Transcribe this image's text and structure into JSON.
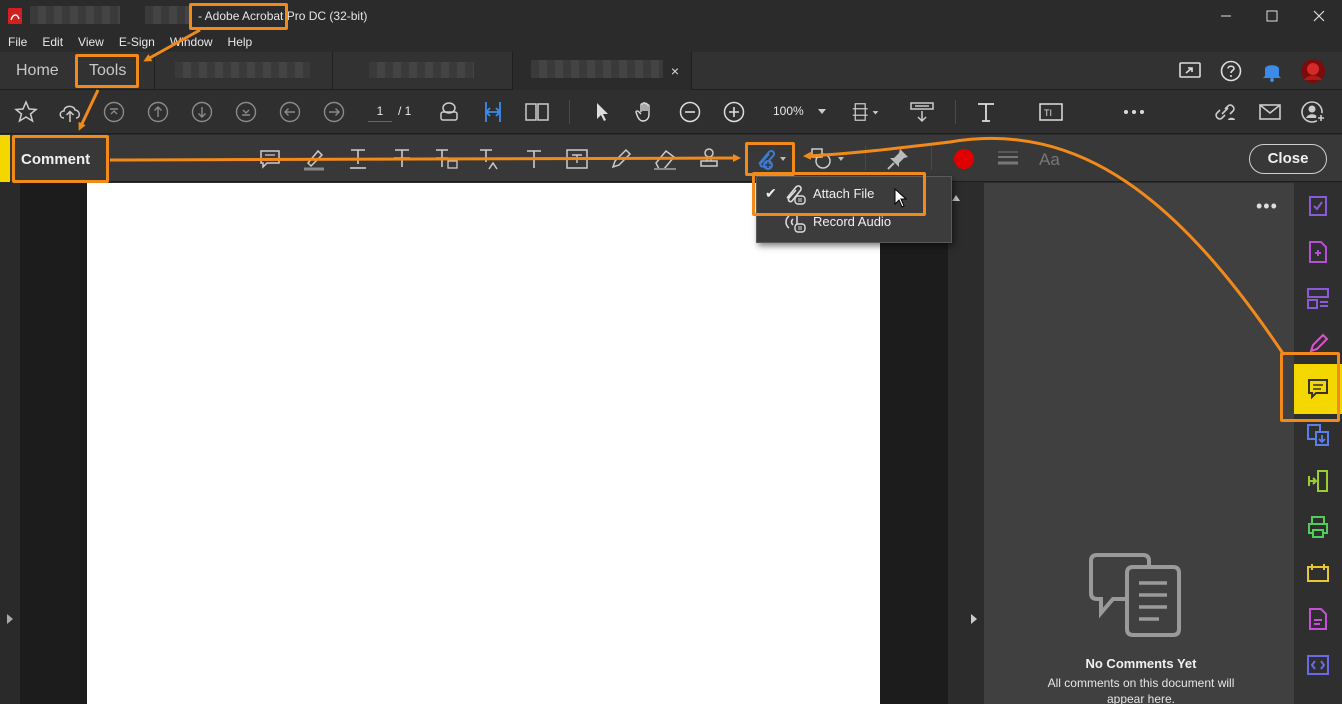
{
  "window": {
    "title": "- Adobe Acrobat Pro DC (32-bit)",
    "controls": [
      "minimize",
      "maximize",
      "close"
    ]
  },
  "menu": {
    "items": [
      "File",
      "Edit",
      "View",
      "E-Sign",
      "Window",
      "Help"
    ]
  },
  "tabs": {
    "home_label": "Home",
    "tools_label": "Tools",
    "doc_close": "×"
  },
  "toolbar": {
    "page_current": "1",
    "page_total": "/ 1",
    "zoom": "100%"
  },
  "comment_bar": {
    "label": "Comment",
    "close_label": "Close"
  },
  "dropdown": {
    "items": [
      {
        "label": "Attach File",
        "checked": true
      },
      {
        "label": "Record Audio",
        "checked": false
      }
    ]
  },
  "comments_pane": {
    "more": "•••",
    "empty_title": "No Comments Yet",
    "empty_text": "All comments on this document will appear here."
  },
  "icons": {
    "toolbar": [
      "star-icon",
      "cloud-upload-icon",
      "first-page-icon",
      "prev-page-icon",
      "next-page-icon",
      "last-page-icon",
      "back-icon",
      "forward-icon",
      "print-icon",
      "fit-page-icon",
      "two-page-icon",
      "select-arrow-icon",
      "hand-icon",
      "zoom-out-icon",
      "zoom-in-icon",
      "page-layout-icon",
      "scroll-icon",
      "text-icon",
      "text-field-icon",
      "more-icon",
      "link-icon",
      "mail-icon",
      "account-add-icon"
    ],
    "comment_bar": [
      "sticky-note-icon",
      "highlight-icon",
      "underline-icon",
      "strikethrough-icon",
      "replace-text-icon",
      "insert-text-icon",
      "add-text-icon",
      "text-box-icon",
      "pencil-icon",
      "eraser-icon",
      "stamp-icon",
      "attach-file-icon",
      "shapes-icon",
      "pin-icon",
      "color-icon",
      "line-weight-icon",
      "font-icon"
    ],
    "rail": [
      "fill-sign-icon",
      "create-pdf-icon",
      "organize-pages-icon",
      "edit-pdf-icon",
      "comment-icon",
      "export-pdf-icon",
      "compress-icon",
      "print-production-icon",
      "redact-icon",
      "protect-icon",
      "javascript-icon"
    ]
  },
  "colors": {
    "accent_yellow": "#f5d700",
    "annotation_orange": "#f28a1b",
    "attach_blue": "#3a7bd5",
    "record_red": "#e00000"
  }
}
